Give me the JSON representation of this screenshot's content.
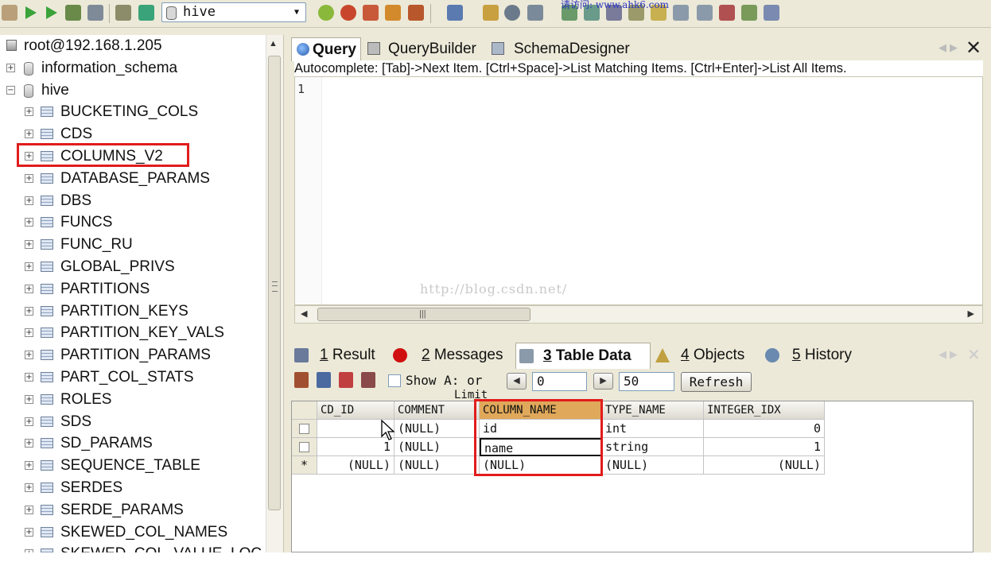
{
  "toolbar": {
    "database_select": "hive",
    "watermark_text": "请访问: www.ahk6.com"
  },
  "tree": {
    "server": "root@192.168.1.205",
    "databases": [
      "information_schema",
      "hive"
    ],
    "tables": [
      "BUCKETING_COLS",
      "CDS",
      "COLUMNS_V2",
      "DATABASE_PARAMS",
      "DBS",
      "FUNCS",
      "FUNC_RU",
      "GLOBAL_PRIVS",
      "PARTITIONS",
      "PARTITION_KEYS",
      "PARTITION_KEY_VALS",
      "PARTITION_PARAMS",
      "PART_COL_STATS",
      "ROLES",
      "SDS",
      "SD_PARAMS",
      "SEQUENCE_TABLE",
      "SERDES",
      "SERDE_PARAMS",
      "SKEWED_COL_NAMES",
      "SKEWED_COL_VALUE_LOC_M"
    ]
  },
  "query": {
    "tabs": [
      "Query",
      "QueryBuilder",
      "SchemaDesigner"
    ],
    "autocomplete": "Autocomplete: [Tab]->Next Item. [Ctrl+Space]->List Matching Items. [Ctrl+Enter]->List All Items.",
    "line_number": "1",
    "watermark": "http://blog.csdn.net/"
  },
  "result_tabs": [
    {
      "num": "1",
      "label": "Result"
    },
    {
      "num": "2",
      "label": "Messages"
    },
    {
      "num": "3",
      "label": "Table Data"
    },
    {
      "num": "4",
      "label": "Objects"
    },
    {
      "num": "5",
      "label": "History"
    }
  ],
  "result_toolbar": {
    "show_all": "Show A: or",
    "limit_label": "Limit",
    "start": "0",
    "count": "50",
    "refresh": "Refresh"
  },
  "grid": {
    "columns": [
      "CD_ID",
      "COMMENT",
      "COLUMN_NAME",
      "TYPE_NAME",
      "INTEGER_IDX"
    ],
    "rows": [
      [
        "",
        "(NULL)",
        "id",
        "int",
        "0"
      ],
      [
        "1",
        "(NULL)",
        "name",
        "string",
        "1"
      ],
      [
        "(NULL)",
        "(NULL)",
        "(NULL)",
        "(NULL)",
        "(NULL)"
      ]
    ],
    "new_row_marker": "*"
  },
  "colors": {
    "highlight_red": "#e11c1c",
    "selected_header": "#e0a85a",
    "chrome": "#ece9d8"
  }
}
